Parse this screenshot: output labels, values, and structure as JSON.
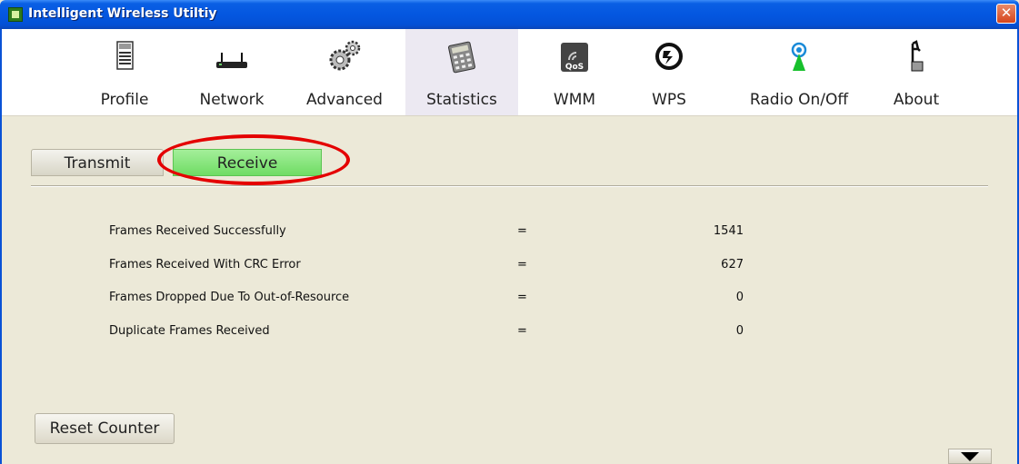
{
  "window": {
    "title": "Intelligent Wireless Utiltiy",
    "close_glyph": "✕"
  },
  "toolbar": [
    {
      "label": "Profile",
      "icon": "profile-icon"
    },
    {
      "label": "Network",
      "icon": "network-icon"
    },
    {
      "label": "Advanced",
      "icon": "gears-icon"
    },
    {
      "label": "Statistics",
      "icon": "calculator-icon",
      "active": true
    },
    {
      "label": "WMM",
      "icon": "qos-icon"
    },
    {
      "label": "WPS",
      "icon": "wps-icon"
    },
    {
      "label": "Radio On/Off",
      "icon": "radio-antenna-icon"
    },
    {
      "label": "About",
      "icon": "about-icon"
    }
  ],
  "tabs": {
    "transmit": "Transmit",
    "receive": "Receive",
    "active": "receive"
  },
  "stats": [
    {
      "label": "Frames Received Successfully",
      "sep": "=",
      "value": "1541"
    },
    {
      "label": "Frames Received With CRC Error",
      "sep": "=",
      "value": "627"
    },
    {
      "label": "Frames Dropped Due To Out-of-Resource",
      "sep": "=",
      "value": "0"
    },
    {
      "label": "Duplicate Frames Received",
      "sep": "=",
      "value": "0"
    }
  ],
  "reset_label": "Reset Counter",
  "colors": {
    "titlebar": "#0457e0",
    "active_tab": "#6fdc64",
    "highlight_ellipse": "#e40000",
    "background": "#ece9d8"
  }
}
